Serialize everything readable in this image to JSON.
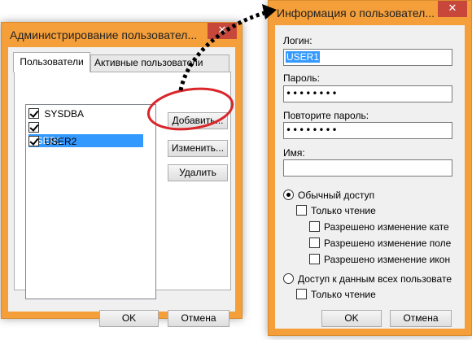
{
  "admin_dialog": {
    "title": "Администрирование пользовател...",
    "close_glyph": "✕",
    "tabs": [
      "Пользователи",
      "Активные пользователи"
    ],
    "users": [
      {
        "name": "SYSDBA",
        "checked": true,
        "selected": false
      },
      {
        "name": "USER1",
        "checked": true,
        "selected": true
      },
      {
        "name": "USER2",
        "checked": true,
        "selected": false
      }
    ],
    "add_label": "Добавить...",
    "edit_label": "Изменить...",
    "delete_label": "Удалить",
    "ok_label": "OK",
    "cancel_label": "Отмена"
  },
  "user_dialog": {
    "title": "Информация о пользовател...",
    "close_glyph": "✕",
    "login_label": "Логин:",
    "login_value": "USER1",
    "password_label": "Пароль:",
    "password_value": "••••••••",
    "confirm_label": "Повторите пароль:",
    "confirm_value": "••••••••",
    "name_label": "Имя:",
    "name_value": "",
    "access_normal": "Обычный доступ",
    "read_only": "Только чтение",
    "allow_cat": "Разрешено изменение кате",
    "allow_fields": "Разрешено изменение поле",
    "allow_icons": "Разрешено изменение икон",
    "access_all": "Доступ к данным всех пользовате",
    "read_only_all": "Только чтение",
    "ok_label": "OK",
    "cancel_label": "Отмена"
  },
  "annotation": {
    "highlight_color": "#d9262b",
    "arrow_color": "#000000"
  }
}
